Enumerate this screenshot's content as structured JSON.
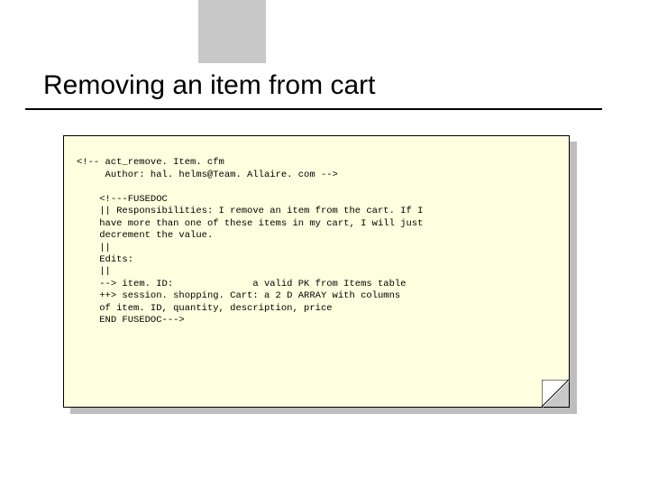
{
  "title": "Removing an item from cart",
  "code": {
    "l01": "<!-- act_remove. Item. cfm",
    "l02": "     Author: hal. helms@Team. Allaire. com -->",
    "l03": "",
    "l04": "    <!---FUSEDOC",
    "l05": "    || Responsibilities: I remove an item from the cart. If I",
    "l06": "    have more than one of these items in my cart, I will just",
    "l07": "    decrement the value.",
    "l08": "    ||",
    "l09": "    Edits:",
    "l10": "    ||",
    "l11": "    --> item. ID:              a valid PK from Items table",
    "l12": "    ++> session. shopping. Cart: a 2 D ARRAY with columns",
    "l13": "    of item. ID, quantity, description, price",
    "l14": "    END FUSEDOC--->"
  }
}
